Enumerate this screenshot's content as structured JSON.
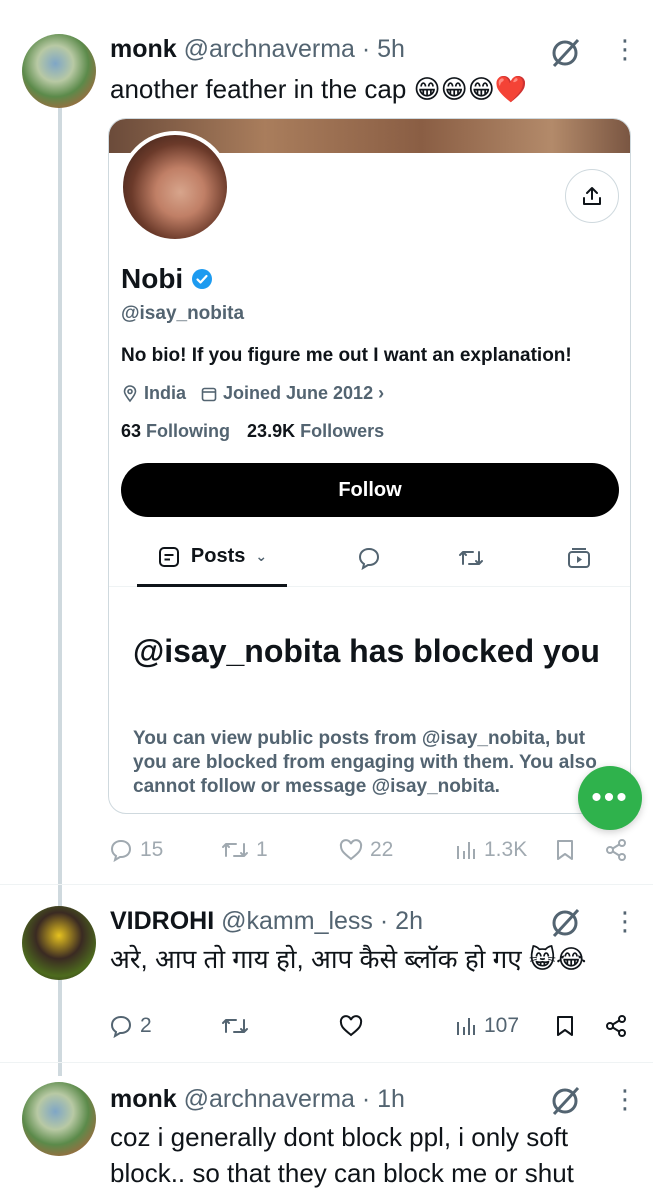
{
  "tweets": [
    {
      "name": "monk",
      "handle": "@archnaverma",
      "time": "· 5h",
      "text": "another feather in the cap 😁😁😁❤️",
      "stats": {
        "replies": "15",
        "retweets": "1",
        "likes": "22",
        "views": "1.3K"
      }
    },
    {
      "name": "VIDROHI",
      "handle": "@kamm_less",
      "time": "· 2h",
      "text": "अरे, आप तो गाय हो, आप कैसे ब्लॉक हो गए 😸😂",
      "stats": {
        "replies": "2",
        "retweets": "",
        "likes": "",
        "views": "107"
      }
    },
    {
      "name": "monk",
      "handle": "@archnaverma",
      "time": "· 1h",
      "text_line1": "coz i generally dont block ppl, i only soft",
      "text_line2": "block.. so that they can block me or shut"
    }
  ],
  "profile_card": {
    "name": "Nobi",
    "handle": "@isay_nobita",
    "bio": "No bio! If you figure me out I want an explanation!",
    "location": "India",
    "joined": "Joined June 2012",
    "following_count": "63",
    "following_label": "Following",
    "followers_count": "23.9K",
    "followers_label": "Followers",
    "follow_label": "Follow",
    "tab_posts": "Posts",
    "blocked_title": "@isay_nobita has blocked you",
    "blocked_desc": "You can view public posts from @isay_nobita, but you are blocked from engaging with them. You also cannot follow or message @isay_nobita."
  },
  "fab_label": "•••",
  "colors": {
    "verified": "#1d9bf0",
    "fab": "#2fb24c",
    "text": "#0f1419",
    "muted": "#536471"
  }
}
